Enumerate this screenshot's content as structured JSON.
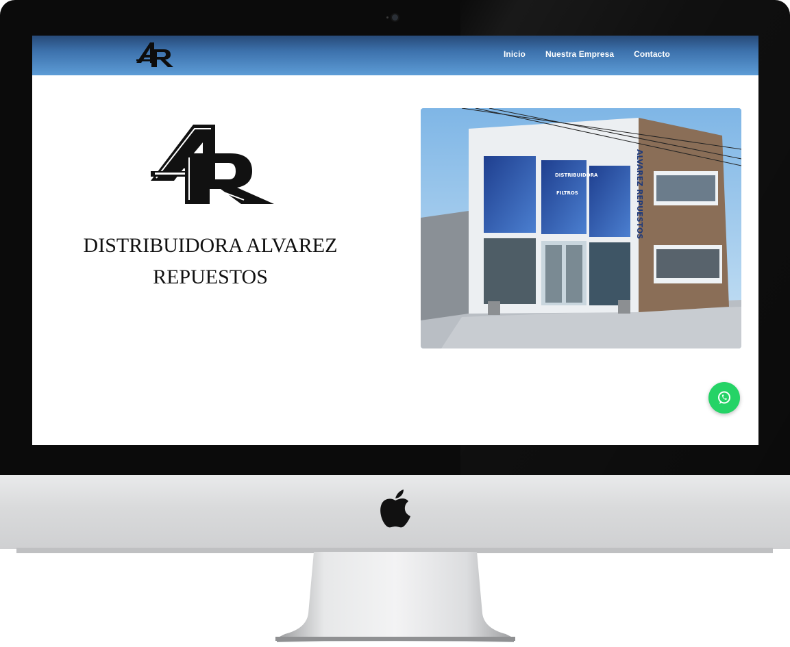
{
  "nav": {
    "logo_alt": "AR",
    "links": [
      {
        "label": "Inicio"
      },
      {
        "label": "Nuestra Empresa"
      },
      {
        "label": "Contacto"
      }
    ]
  },
  "hero": {
    "company_line1": "DISTRIBUIDORA ALVAREZ",
    "company_line2": "REPUESTOS"
  },
  "photo": {
    "sign_vertical": "ALVAREZ REPUESTOS",
    "sign_brand": "DISTRIBUIDORA",
    "sign_filters": "FILTROS"
  },
  "icons": {
    "whatsapp": "whatsapp-icon",
    "apple": "apple-logo-icon"
  },
  "colors": {
    "navbar_top": "#274a78",
    "navbar_bottom": "#5d9cd6",
    "whatsapp": "#25d366"
  }
}
